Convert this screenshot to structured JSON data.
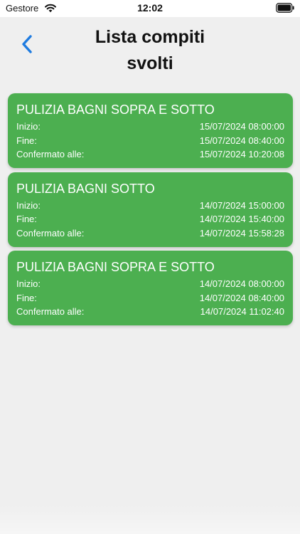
{
  "status_bar": {
    "carrier": "Gestore",
    "time": "12:02",
    "icons": [
      "wifi-icon",
      "battery-icon"
    ]
  },
  "header": {
    "title_line1": "Lista compiti",
    "title_line2": "svolti",
    "back_icon": "chevron-left-icon"
  },
  "colors": {
    "card_bg": "#4caf50",
    "accent": "#1e7be0",
    "background": "#efefef"
  },
  "tasks": [
    {
      "title": "PULIZIA BAGNI SOPRA E SOTTO",
      "start_label": "Inizio:",
      "start_value": "15/07/2024 08:00:00",
      "end_label": "Fine:",
      "end_value": "15/07/2024 08:40:00",
      "confirmed_label": "Confermato alle:",
      "confirmed_value": "15/07/2024 10:20:08"
    },
    {
      "title": "PULIZIA BAGNI SOTTO",
      "start_label": "Inizio:",
      "start_value": "14/07/2024 15:00:00",
      "end_label": "Fine:",
      "end_value": "14/07/2024 15:40:00",
      "confirmed_label": "Confermato alle:",
      "confirmed_value": "14/07/2024 15:58:28"
    },
    {
      "title": "PULIZIA BAGNI SOPRA E SOTTO",
      "start_label": "Inizio:",
      "start_value": "14/07/2024 08:00:00",
      "end_label": "Fine:",
      "end_value": "14/07/2024 08:40:00",
      "confirmed_label": "Confermato alle:",
      "confirmed_value": "14/07/2024 11:02:40"
    }
  ]
}
